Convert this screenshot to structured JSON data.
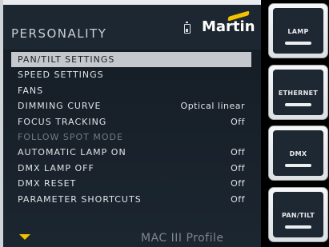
{
  "header": {
    "title": "PERSONALITY",
    "battery_icon": "battery-icon",
    "logo_text": "Martin"
  },
  "menu": {
    "items": [
      {
        "label": "PAN/TILT SETTINGS",
        "value": "",
        "state": "selected"
      },
      {
        "label": "SPEED SETTINGS",
        "value": "",
        "state": "normal"
      },
      {
        "label": "FANS",
        "value": "",
        "state": "normal"
      },
      {
        "label": "DIMMING CURVE",
        "value": "Optical linear",
        "state": "normal"
      },
      {
        "label": "FOCUS TRACKING",
        "value": "Off",
        "state": "normal"
      },
      {
        "label": "FOLLOW SPOT MODE",
        "value": "",
        "state": "disabled"
      },
      {
        "label": "AUTOMATIC LAMP ON",
        "value": "Off",
        "state": "normal"
      },
      {
        "label": "DMX LAMP OFF",
        "value": "Off",
        "state": "normal"
      },
      {
        "label": "DMX RESET",
        "value": "Off",
        "state": "normal"
      },
      {
        "label": "PARAMETER SHORTCUTS",
        "value": "Off",
        "state": "normal"
      }
    ],
    "more_indicator_icon": "scroll-down-arrow-icon"
  },
  "footer": {
    "model": "MAC III Profile"
  },
  "softkeys": [
    {
      "label": "LAMP"
    },
    {
      "label": "ETHERNET"
    },
    {
      "label": "DMX"
    },
    {
      "label": "PAN/TILT"
    }
  ],
  "colors": {
    "accent": "#f2c200",
    "selected_row": "#c4c8cd",
    "background": "#1c2630"
  }
}
